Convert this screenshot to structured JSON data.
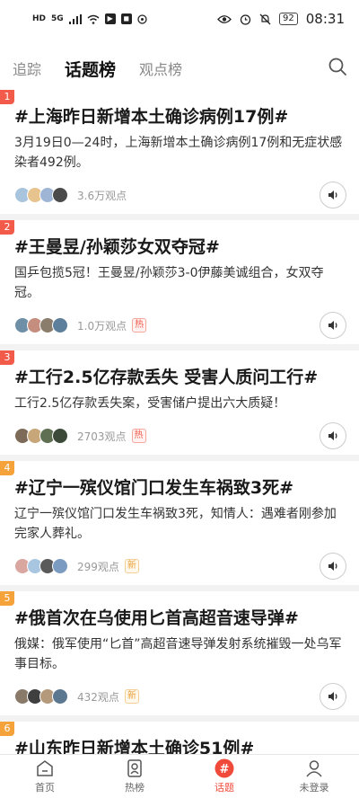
{
  "status_bar": {
    "left_tags": [
      "HD",
      "5G"
    ],
    "battery": "92",
    "time": "08:31"
  },
  "tabs": [
    {
      "label": "追踪",
      "active": false
    },
    {
      "label": "话题榜",
      "active": true
    },
    {
      "label": "观点榜",
      "active": false
    }
  ],
  "colors": {
    "accent": "#f04a3a",
    "rank_hot": "#f25a4a",
    "rank_warm": "#f5a23a"
  },
  "topics": [
    {
      "rank": "1",
      "title": "#上海昨日新增本土确诊病例17例#",
      "desc": "3月19日0—24时，上海新增本土确诊病例17例和无症状感染者492例。",
      "views": "3.6万观点",
      "badge": "",
      "rank_color": "#f25a4a",
      "avatars": [
        "#a9c4dd",
        "#e7c38d",
        "#9fb5d6",
        "#4b4b4b"
      ]
    },
    {
      "rank": "2",
      "title": "#王曼昱/孙颖莎女双夺冠#",
      "desc": "国乒包揽5冠！王曼昱/孙颖莎3-0伊藤美诚组合，女双夺冠。",
      "views": "1.0万观点",
      "badge": "热",
      "badge_type": "hot",
      "rank_color": "#f25a4a",
      "avatars": [
        "#6f8fa6",
        "#c48d7e",
        "#8b7d6b",
        "#5e7f9c"
      ]
    },
    {
      "rank": "3",
      "title": "#工行2.5亿存款丢失 受害人质问工行#",
      "desc": "工行2.5亿存款丢失案，受害储户提出六大质疑！",
      "views": "2703观点",
      "badge": "热",
      "badge_type": "hot",
      "rank_color": "#f25a4a",
      "avatars": [
        "#7d6a58",
        "#c7a77a",
        "#5f6f52",
        "#3d4a3a"
      ]
    },
    {
      "rank": "4",
      "title": "#辽宁一殡仪馆门口发生车祸致3死#",
      "desc": "辽宁一殡仪馆门口发生车祸致3死，知情人：遇难者刚参加完家人葬礼。",
      "views": "299观点",
      "badge": "新",
      "badge_type": "new",
      "rank_color": "#f5a23a",
      "avatars": [
        "#d9a7a0",
        "#a8c6e0",
        "#5a5a5a",
        "#7b9cc0"
      ]
    },
    {
      "rank": "5",
      "title": "#俄首次在乌使用匕首高超音速导弹#",
      "desc": "俄媒：俄军使用“匕首”高超音速导弹发射系统摧毁一处乌军事目标。",
      "views": "432观点",
      "badge": "新",
      "badge_type": "new",
      "rank_color": "#f5a23a",
      "avatars": [
        "#8a7a6a",
        "#3f3f3f",
        "#b49a7a",
        "#5c7890"
      ]
    },
    {
      "rank": "6",
      "title": "#山东昨日新增本土确诊51例#",
      "desc": "",
      "views": "",
      "badge": "",
      "rank_color": "#f5a23a",
      "avatars": []
    }
  ],
  "bottom_nav": [
    {
      "label": "首页",
      "icon": "home-icon",
      "active": false
    },
    {
      "label": "热榜",
      "icon": "hot-list-icon",
      "active": false
    },
    {
      "label": "话题",
      "icon": "topic-icon",
      "active": true
    },
    {
      "label": "未登录",
      "icon": "user-icon",
      "active": false
    }
  ]
}
